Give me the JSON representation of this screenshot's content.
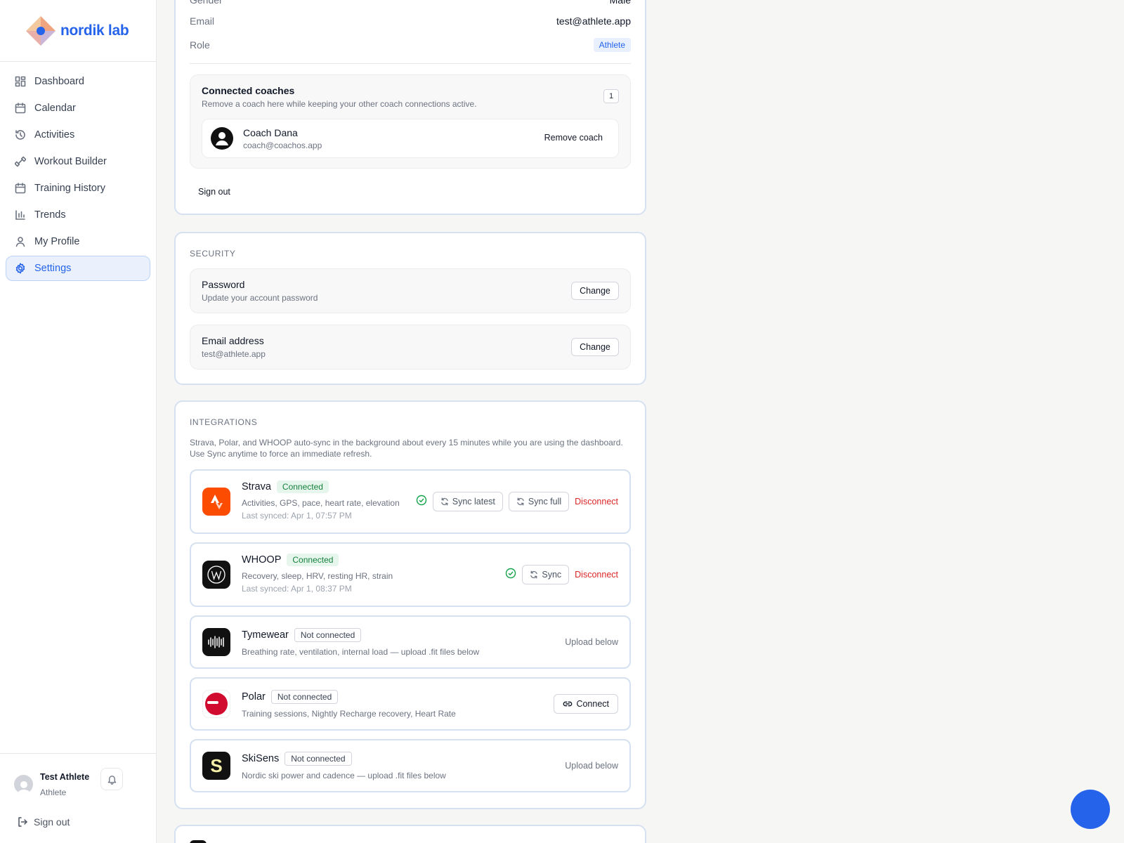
{
  "brand": {
    "name": "nordik lab"
  },
  "sidebar": {
    "items": [
      {
        "label": "Dashboard",
        "icon": "dashboard-icon"
      },
      {
        "label": "Calendar",
        "icon": "calendar-icon"
      },
      {
        "label": "Activities",
        "icon": "history-icon"
      },
      {
        "label": "Workout Builder",
        "icon": "dumbbell-icon"
      },
      {
        "label": "Training History",
        "icon": "calendar-icon"
      },
      {
        "label": "Trends",
        "icon": "bar-chart-icon"
      },
      {
        "label": "My Profile",
        "icon": "user-icon"
      },
      {
        "label": "Settings",
        "icon": "gear-icon",
        "active": true
      }
    ],
    "user": {
      "name": "Test Athlete",
      "role": "Athlete"
    },
    "signout": "Sign out"
  },
  "profile": {
    "gender_label": "Gender",
    "gender_value": "Male",
    "email_label": "Email",
    "email_value": "test@athlete.app",
    "role_label": "Role",
    "role_value": "Athlete",
    "coaches": {
      "title": "Connected coaches",
      "subtitle": "Remove a coach here while keeping your other coach connections active.",
      "count": "1",
      "coach_name": "Coach Dana",
      "coach_email": "coach@coachos.app",
      "remove_label": "Remove coach"
    },
    "signout": "Sign out"
  },
  "security": {
    "title": "SECURITY",
    "password_title": "Password",
    "password_sub": "Update your account password",
    "email_title": "Email address",
    "email_sub": "test@athlete.app",
    "change_label": "Change"
  },
  "integrations": {
    "title": "INTEGRATIONS",
    "desc_line1": "Strava, Polar, and WHOOP auto-sync in the background about every 15 minutes while you are using the dashboard.",
    "desc_line2": "Use Sync anytime to force an immediate refresh.",
    "strava": {
      "name": "Strava",
      "status": "Connected",
      "desc": "Activities, GPS, pace, heart rate, elevation",
      "synced": "Last synced: Apr 1, 07:57 PM",
      "sync_latest": "Sync latest",
      "sync_full": "Sync full",
      "disconnect": "Disconnect",
      "color": "#fc4c02"
    },
    "whoop": {
      "name": "WHOOP",
      "status": "Connected",
      "desc": "Recovery, sleep, HRV, resting HR, strain",
      "synced": "Last synced: Apr 1, 08:37 PM",
      "sync": "Sync",
      "disconnect": "Disconnect"
    },
    "tymewear": {
      "name": "Tymewear",
      "status": "Not connected",
      "desc": "Breathing rate, ventilation, internal load — upload .fit files below",
      "action": "Upload below"
    },
    "polar": {
      "name": "Polar",
      "status": "Not connected",
      "desc": "Training sessions, Nightly Recharge recovery, Heart Rate",
      "action": "Connect",
      "color": "#d10a2f"
    },
    "skisens": {
      "name": "SkiSens",
      "status": "Not connected",
      "desc": "Nordic ski power and cadence — upload .fit files below",
      "action": "Upload below"
    }
  },
  "colors": {
    "accent": "#2563eb",
    "success": "#15803d",
    "danger": "#dc2626"
  }
}
